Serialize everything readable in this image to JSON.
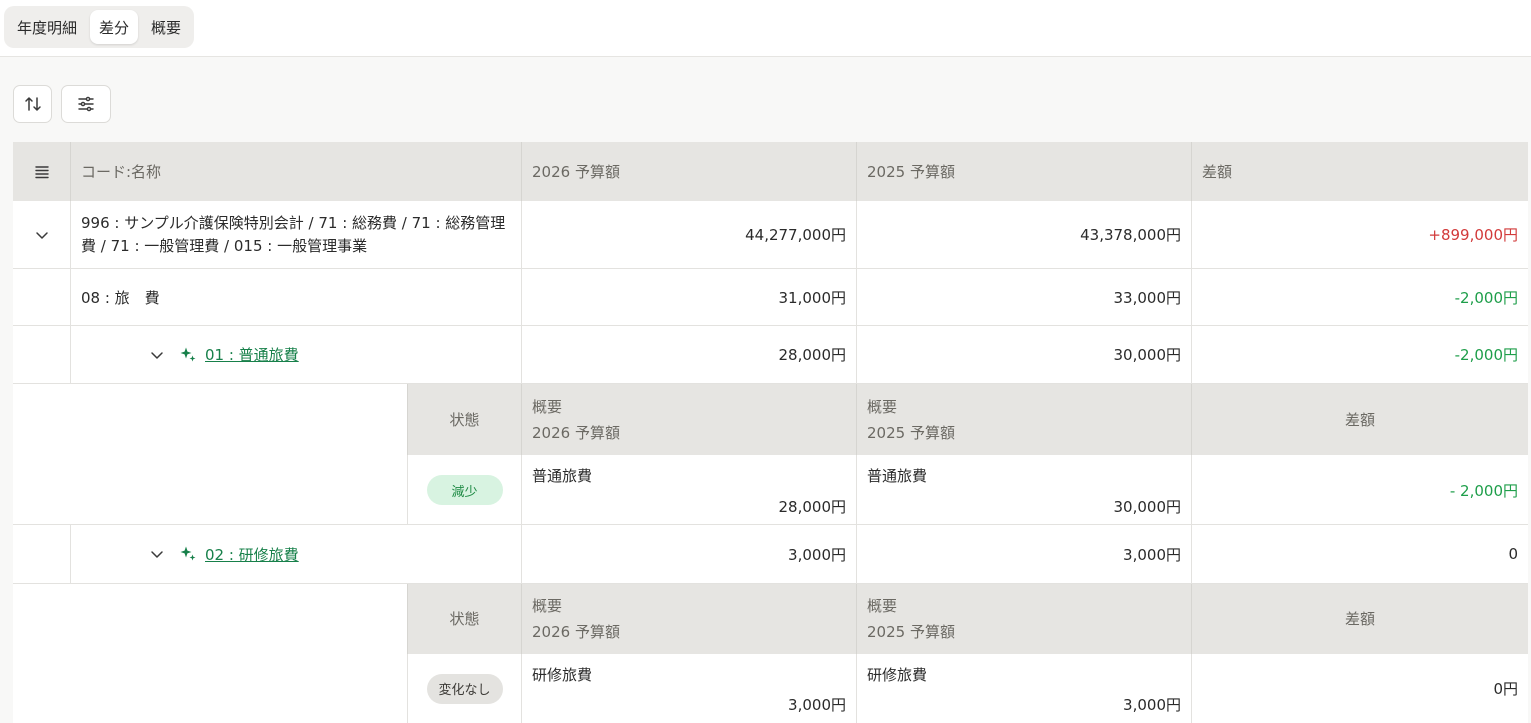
{
  "tabs": [
    {
      "label": "年度明細",
      "active": false
    },
    {
      "label": "差分",
      "active": true
    },
    {
      "label": "概要",
      "active": false
    }
  ],
  "table": {
    "headers": {
      "code_name": "コード:名称",
      "budget_2026": "2026 予算額",
      "budget_2025": "2025 予算額",
      "diff": "差額"
    },
    "rows": [
      {
        "name": "996 : サンプル介護保険特別会計 / 71 : 総務費 / 71 : 総務管理費 / 71 : 一般管理費 / 015 : 一般管理事業",
        "budget_2026": "44,277,000円",
        "budget_2025": "43,378,000円",
        "diff": "+899,000円"
      },
      {
        "name": "08 : 旅　費",
        "budget_2026": "31,000円",
        "budget_2025": "33,000円",
        "diff": "-2,000円"
      },
      {
        "name": "01 : 普通旅費",
        "budget_2026": "28,000円",
        "budget_2025": "30,000円",
        "diff": "-2,000円"
      },
      {
        "name": "02 : 研修旅費",
        "budget_2026": "3,000円",
        "budget_2025": "3,000円",
        "diff": "0"
      }
    ],
    "sub_headers": {
      "status": "状態",
      "summary": "概要",
      "budget_2026": "2026 予算額",
      "budget_2025": "2025 予算額",
      "diff": "差額"
    },
    "details": [
      {
        "status": "減少",
        "name_2026": "普通旅費",
        "amount_2026": "28,000円",
        "name_2025": "普通旅費",
        "amount_2025": "30,000円",
        "diff": "- 2,000円"
      },
      {
        "status": "変化なし",
        "name_2026": "研修旅費",
        "amount_2026": "3,000円",
        "name_2025": "研修旅費",
        "amount_2025": "3,000円",
        "diff": "0円"
      }
    ]
  },
  "colors": {
    "positive": "#d23a3a",
    "negative": "#1e9e4a",
    "link": "#17804a",
    "header_bg": "#e6e5e2"
  },
  "icons": {
    "sort": "sort-arrows-icon",
    "filter": "sliders-icon",
    "columns": "list-icon",
    "expand": "chevron-down-icon",
    "ai": "sparkle-icon"
  }
}
